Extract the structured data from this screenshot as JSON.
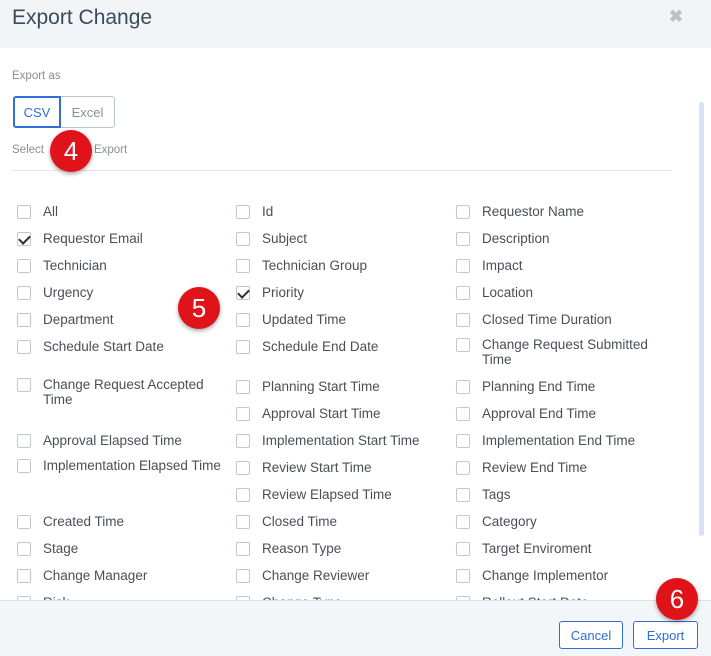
{
  "dialog": {
    "title": "Export Change",
    "close_icon": "close-icon",
    "export_as_label": "Export as",
    "formats": [
      "CSV",
      "Excel"
    ],
    "selected_format": "CSV",
    "select_label": "Select",
    "select_label_tail": "o Export"
  },
  "fields": {
    "col1": [
      {
        "label": "All",
        "checked": false
      },
      {
        "label": "Requestor Email",
        "checked": true
      },
      {
        "label": "Technician",
        "checked": false
      },
      {
        "label": "Urgency",
        "checked": false
      },
      {
        "label": "Department",
        "checked": false
      },
      {
        "label": "Schedule Start Date",
        "checked": false
      },
      {
        "label": "Change Request Accepted Time",
        "checked": false
      },
      {
        "label": "Approval Elapsed Time",
        "checked": false
      },
      {
        "label": "Implementation Elapsed Time",
        "checked": false
      },
      {
        "label": "Created Time",
        "checked": false
      },
      {
        "label": "Stage",
        "checked": false
      },
      {
        "label": "Change Manager",
        "checked": false
      },
      {
        "label": "Risk",
        "checked": false
      }
    ],
    "col2": [
      {
        "label": "Id",
        "checked": false
      },
      {
        "label": "Subject",
        "checked": false
      },
      {
        "label": "Technician Group",
        "checked": false
      },
      {
        "label": "Priority",
        "checked": true
      },
      {
        "label": "Updated Time",
        "checked": false
      },
      {
        "label": "Schedule End Date",
        "checked": false
      },
      {
        "label": "Planning Start Time",
        "checked": false
      },
      {
        "label": "Approval Start Time",
        "checked": false
      },
      {
        "label": "Implementation Start Time",
        "checked": false
      },
      {
        "label": "Review Start Time",
        "checked": false
      },
      {
        "label": "Review Elapsed Time",
        "checked": false
      },
      {
        "label": "Closed Time",
        "checked": false
      },
      {
        "label": "Reason Type",
        "checked": false
      },
      {
        "label": "Change Reviewer",
        "checked": false
      },
      {
        "label": "Change Type",
        "checked": false
      }
    ],
    "col3": [
      {
        "label": "Requestor Name",
        "checked": false
      },
      {
        "label": "Description",
        "checked": false
      },
      {
        "label": "Impact",
        "checked": false
      },
      {
        "label": "Location",
        "checked": false
      },
      {
        "label": "Closed Time Duration",
        "checked": false
      },
      {
        "label": "Change Request Submitted Time",
        "checked": false
      },
      {
        "label": "Planning End Time",
        "checked": false
      },
      {
        "label": "Approval End Time",
        "checked": false
      },
      {
        "label": "Implementation End Time",
        "checked": false
      },
      {
        "label": "Review End Time",
        "checked": false
      },
      {
        "label": "Tags",
        "checked": false
      },
      {
        "label": "Category",
        "checked": false
      },
      {
        "label": "Target Enviroment",
        "checked": false
      },
      {
        "label": "Change Implementor",
        "checked": false
      },
      {
        "label": "Rollout Start Date",
        "checked": false
      }
    ]
  },
  "footer": {
    "cancel_label": "Cancel",
    "export_label": "Export"
  },
  "annotations": {
    "step_4": "4",
    "step_5": "5",
    "step_6": "6"
  },
  "colors": {
    "accent": "#2f6fd6",
    "badge": "#e0131b",
    "header_bg": "#f2f5f8"
  }
}
